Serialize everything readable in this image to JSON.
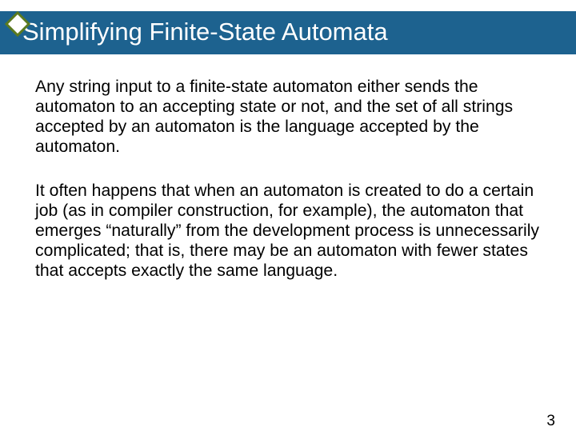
{
  "header": {
    "title": "Simplifying Finite-State Automata"
  },
  "body": {
    "para1": "Any string input to a finite-state automaton either sends the automaton to an accepting state or not, and the set of all strings accepted by an automaton is the language accepted by the automaton.",
    "para2": "It often happens that when an automaton is created to do a certain job (as in compiler construction, for example), the automaton that emerges “naturally” from the development process is unnecessarily complicated; that is, there may be an automaton with fewer states that accepts exactly the same language."
  },
  "footer": {
    "page_number": "3"
  },
  "decor": {
    "diamond": {
      "stroke": "#5b7a1f",
      "fill": "#ffffff"
    }
  }
}
